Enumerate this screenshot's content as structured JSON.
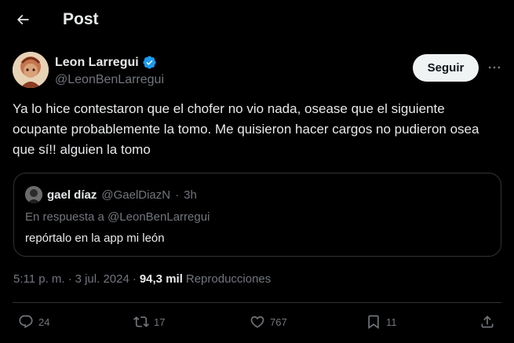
{
  "header": {
    "title": "Post"
  },
  "author": {
    "name": "Leon Larregui",
    "handle": "@LeonBenLarregui",
    "verified_color": "#1d9bf0",
    "follow_label": "Seguir"
  },
  "tweet": {
    "text": "Ya lo hice contestaron que el chofer no vio nada, osease que el siguiente ocupante probablemente la tomo. Me quisieron hacer cargos no pudieron osea que sí!! alguien la tomo"
  },
  "quote": {
    "name": "gael díaz",
    "handle": "@GaelDiazN",
    "separator": "·",
    "time": "3h",
    "reply_to": "En respuesta a @LeonBenLarregui",
    "text": "repórtalo en la app mi león"
  },
  "meta": {
    "time": "5:11 p. m.",
    "separator": "·",
    "date": "3 jul. 2024",
    "separator2": "·",
    "views": "94,3 mil",
    "views_label": "Reproducciones"
  },
  "actions": {
    "replies": "24",
    "reposts": "17",
    "likes": "767",
    "bookmarks": "11"
  },
  "icons": {
    "back": "arrow-left-icon",
    "verified": "verified-badge-icon",
    "more": "more-horizontal-icon",
    "reply": "reply-icon",
    "repost": "repost-icon",
    "like": "heart-icon",
    "bookmark": "bookmark-icon",
    "share": "share-icon"
  }
}
